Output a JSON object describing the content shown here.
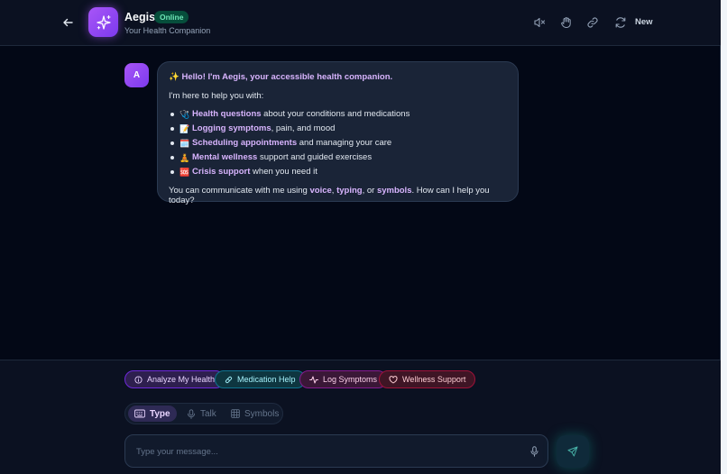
{
  "header": {
    "app_name": "Aegis",
    "status": "Online",
    "subtitle": "Your Health Companion",
    "new_label": "New",
    "icons": [
      "back-arrow-icon",
      "sparkle-icon",
      "mute-icon",
      "hand-icon",
      "link-icon",
      "refresh-icon"
    ]
  },
  "message": {
    "avatar": "A",
    "greeting": "✨ Hello! I'm Aegis, your accessible health companion.",
    "intro": "I'm here to help you with:",
    "items": [
      {
        "emoji": "🩺",
        "title": "Health questions",
        "rest": " about your conditions and medications"
      },
      {
        "emoji": "📝",
        "title": "Logging symptoms",
        "rest": ", pain, and mood"
      },
      {
        "emoji": "🗓️",
        "title": "Scheduling appointments",
        "rest": " and managing your care"
      },
      {
        "emoji": "🧘",
        "title": "Mental wellness",
        "rest": " support and guided exercises"
      },
      {
        "emoji": "🆘",
        "title": "Crisis support",
        "rest": " when you need it"
      }
    ],
    "outro": {
      "before": "You can communicate with me using ",
      "kw1": "voice",
      "sep1": ", ",
      "kw2": "typing",
      "sep2": ", or ",
      "kw3": "symbols",
      "after": ". How can I help you today?"
    }
  },
  "quick_actions": [
    {
      "label": "Analyze My Health",
      "icon": "info-circle-icon"
    },
    {
      "label": "Medication Help",
      "icon": "pill-icon"
    },
    {
      "label": "Log Symptoms",
      "icon": "activity-icon"
    },
    {
      "label": "Wellness Support",
      "icon": "heart-icon"
    }
  ],
  "modes": [
    {
      "label": "Type",
      "icon": "keyboard-icon",
      "active": true
    },
    {
      "label": "Talk",
      "icon": "mic-icon",
      "active": false
    },
    {
      "label": "Symbols",
      "icon": "grid-icon",
      "active": false
    }
  ],
  "input": {
    "placeholder": "Type your message...",
    "value": ""
  },
  "colors": {
    "accent": "#a855f7",
    "online": "#6ee7b7",
    "background": "#030816"
  }
}
